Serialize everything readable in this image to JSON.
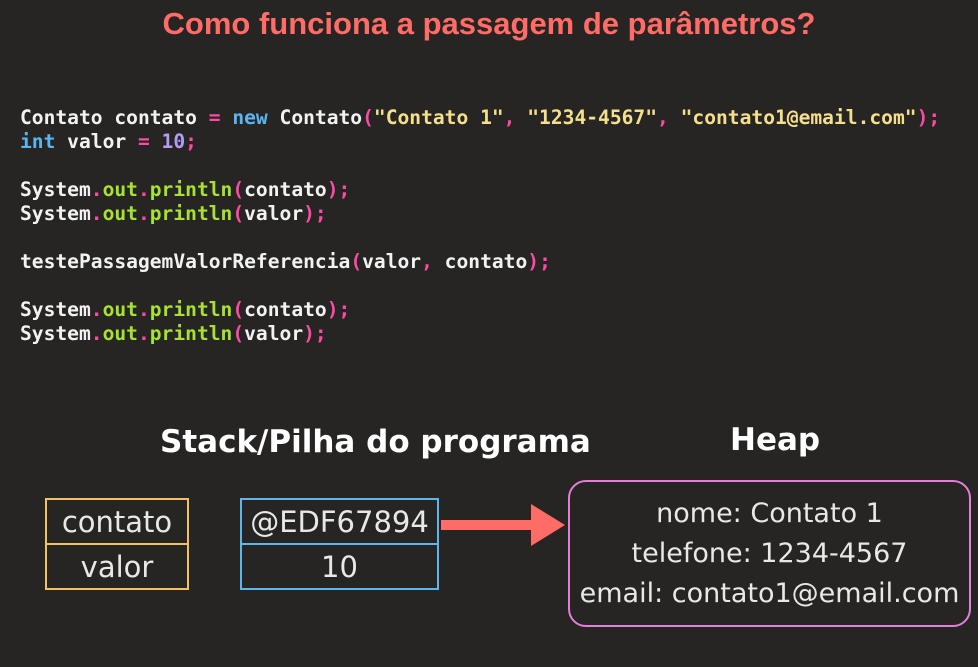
{
  "title": "Como funciona a passagem de parâmetros?",
  "code": {
    "l1": {
      "a": "Contato contato ",
      "eq": "=",
      "new": " new",
      "b": " Contato",
      "p1": "(",
      "s1": "\"Contato 1\"",
      "c1": ", ",
      "s2": "\"1234-4567\"",
      "c2": ", ",
      "s3": "\"contato1@email.com\"",
      "p2": ")",
      "semi": ";"
    },
    "l2": {
      "type": "int",
      "a": " valor ",
      "eq": "=",
      "num": " 10",
      "semi": ";"
    },
    "print": {
      "system": "System",
      "dot": ".",
      "out": "out",
      "println": "println",
      "open": "(",
      "close": ")",
      "semi": ";"
    },
    "arg_contato": "contato",
    "arg_valor": "valor",
    "call": {
      "fn": "testePassagemValorReferencia",
      "open": "(",
      "a1": "valor",
      "comma": ",",
      "a2": " contato",
      "close": ")",
      "semi": ";"
    }
  },
  "stack": {
    "title": "Stack/Pilha do programa",
    "vars": [
      {
        "name": "contato",
        "value": "@EDF67894"
      },
      {
        "name": "valor",
        "value": "10"
      }
    ]
  },
  "heap": {
    "title": "Heap",
    "lines": [
      "nome: Contato 1",
      "telefone: 1234-4567",
      "email: contato1@email.com"
    ]
  },
  "colors": {
    "background": "#262524",
    "title": "#ff6b66",
    "name_border": "#f3c064",
    "value_border": "#5fb6ea",
    "heap_border": "#e27fd6",
    "arrow": "#ff6b66"
  }
}
